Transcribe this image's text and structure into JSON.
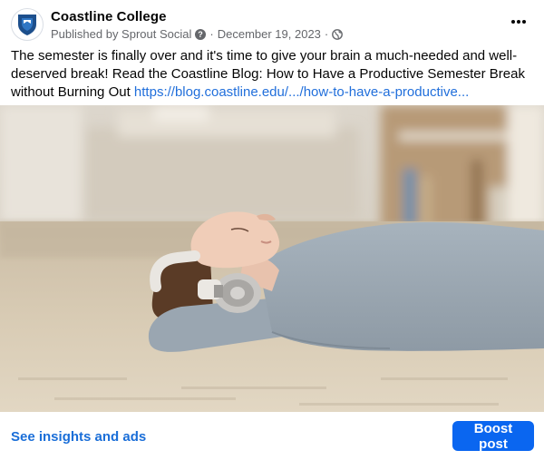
{
  "post": {
    "page_name": "Coastline College",
    "published_by": "Published by Sprout Social",
    "date": "December 19, 2023",
    "audience_icon": "globe-icon",
    "caption_text": "The semester is finally over and it's time to give your brain a much-needed and well-deserved break! Read the Coastline Blog: How to Have a Productive Semester Break without Burning Out ",
    "caption_link": "https://blog.coastline.edu/.../how-to-have-a-productive...",
    "image_alt": "Woman relaxing on a carpet wearing headphones"
  },
  "footer": {
    "insights_label": "See insights and ads",
    "boost_label": "Boost post"
  },
  "colors": {
    "link": "#216fdb",
    "boost_button": "#0a66f0",
    "brand_shield": "#1d4f8c"
  }
}
